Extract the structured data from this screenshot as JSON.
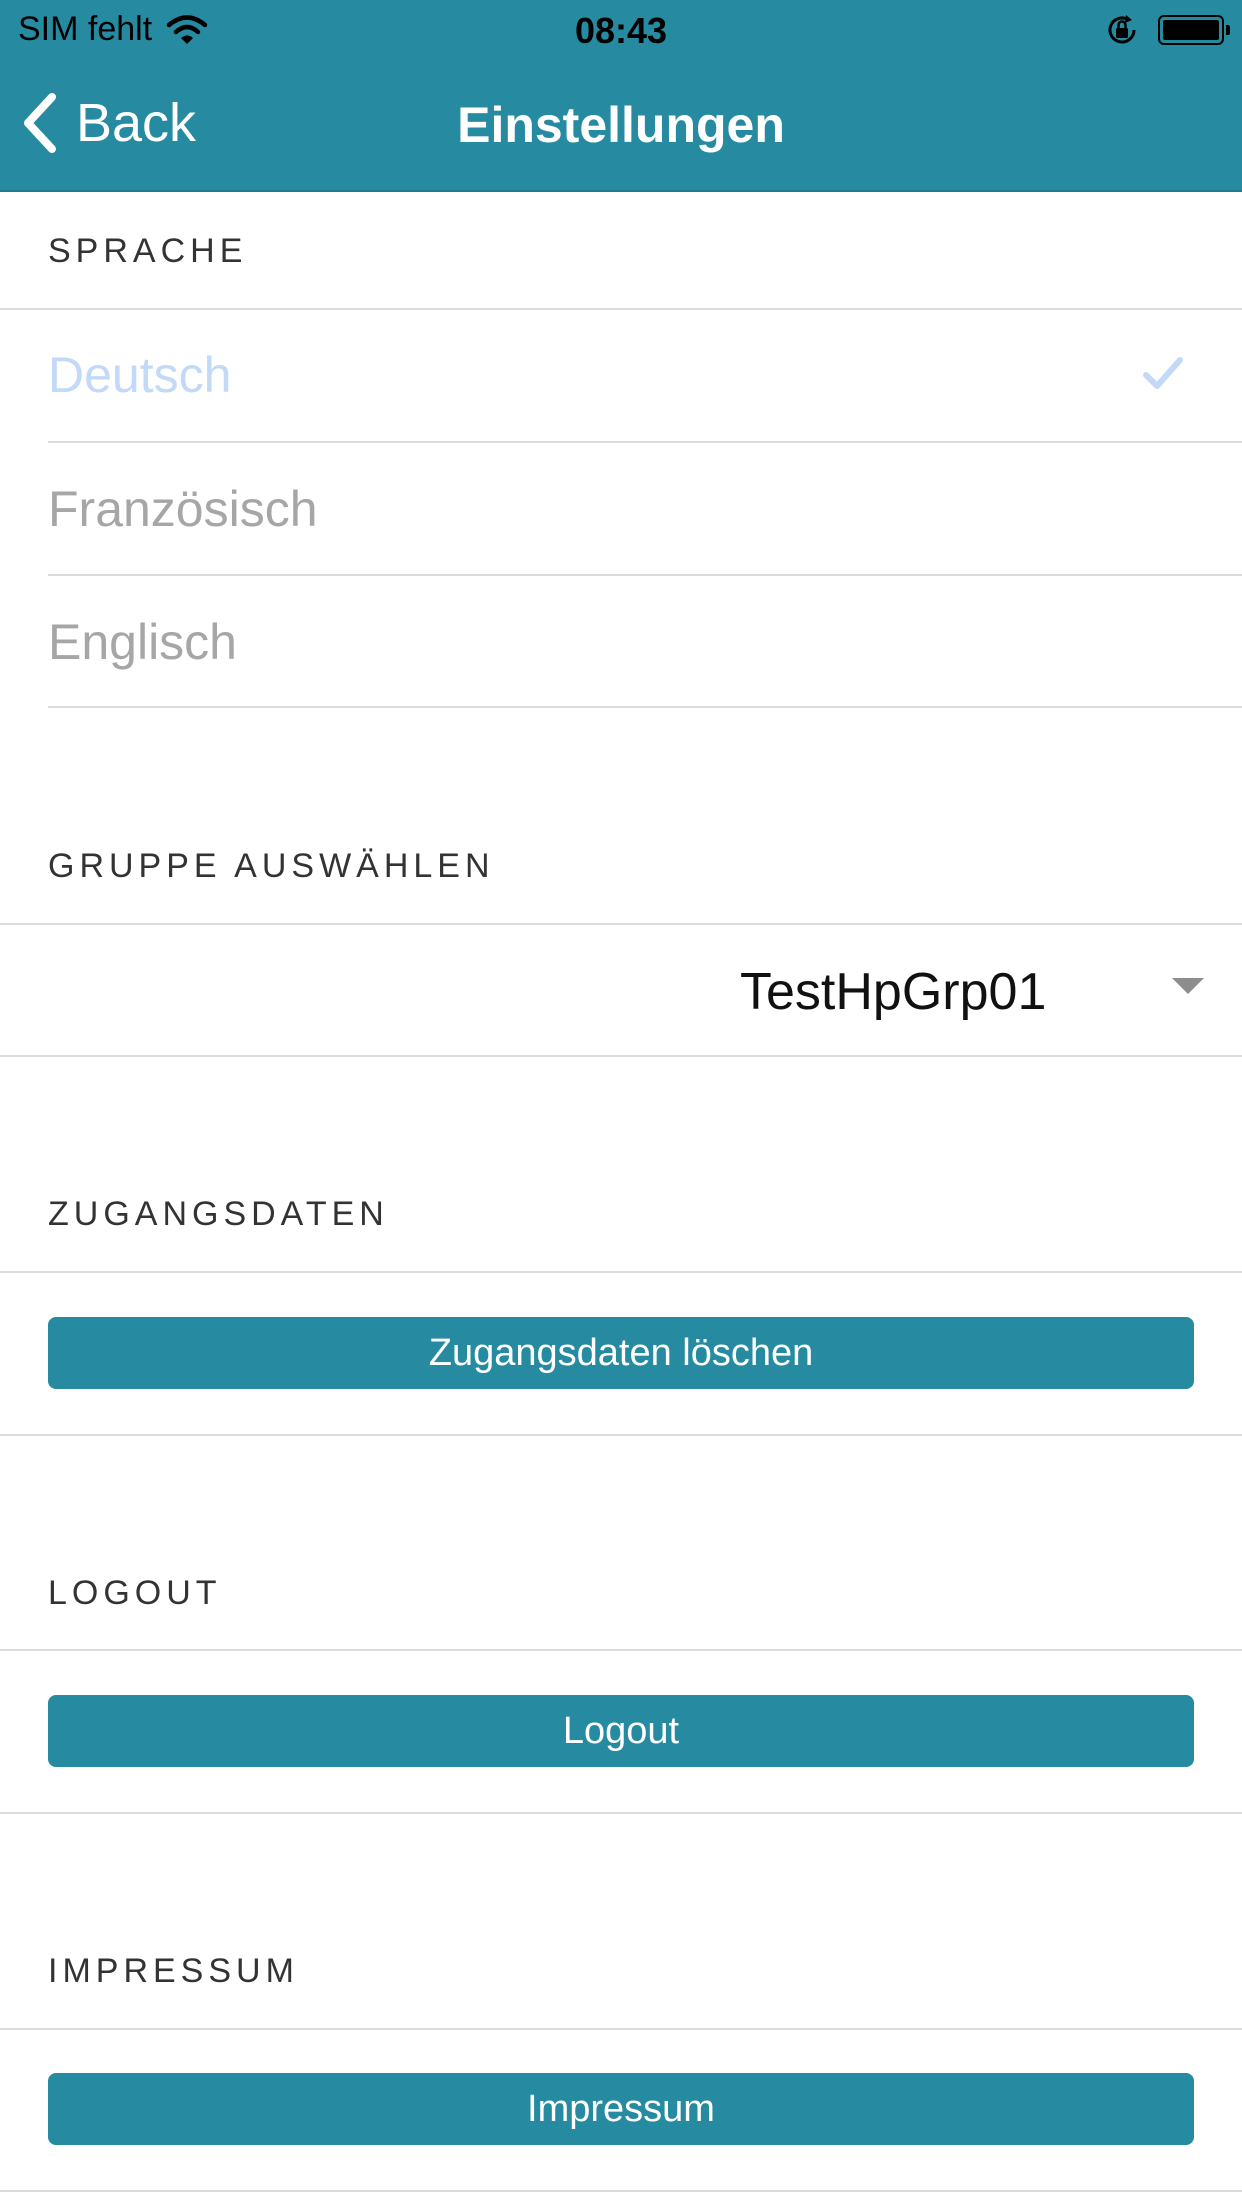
{
  "status_bar": {
    "carrier": "SIM fehlt",
    "time": "08:43"
  },
  "nav": {
    "back_label": "Back",
    "title": "Einstellungen"
  },
  "language": {
    "header": "SPRACHE",
    "items": [
      {
        "label": "Deutsch",
        "selected": true
      },
      {
        "label": "Französisch",
        "selected": false
      },
      {
        "label": "Englisch",
        "selected": false
      }
    ]
  },
  "group": {
    "header": "GRUPPE AUSWÄHLEN",
    "selected_value": "TestHpGrp01"
  },
  "credentials": {
    "header": "ZUGANGSDATEN",
    "button_label": "Zugangsdaten löschen"
  },
  "logout": {
    "header": "LOGOUT",
    "button_label": "Logout"
  },
  "imprint": {
    "header": "IMPRESSUM",
    "button_label": "Impressum"
  },
  "colors": {
    "accent": "#268ba1",
    "selected_text": "#c2d9f7",
    "inactive_text": "#a6a6a6"
  }
}
